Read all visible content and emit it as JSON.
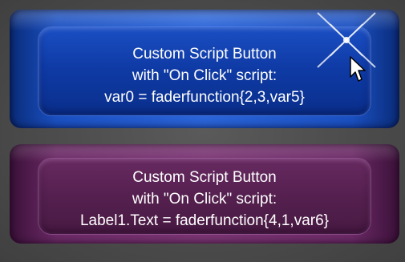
{
  "buttons": [
    {
      "lines": [
        "Custom Script Button",
        "with \"On Click\" script:",
        "var0 = faderfunction{2,3,var5}"
      ],
      "color": "#1a4fc0"
    },
    {
      "lines": [
        "Custom Script Button",
        "with \"On Click\" script:",
        "Label1.Text = faderfunction{4,1,var6}"
      ],
      "color": "#6b2a66"
    }
  ],
  "icons": {
    "sparkle": "sparkle-icon",
    "cursor": "mouse-pointer-icon"
  }
}
